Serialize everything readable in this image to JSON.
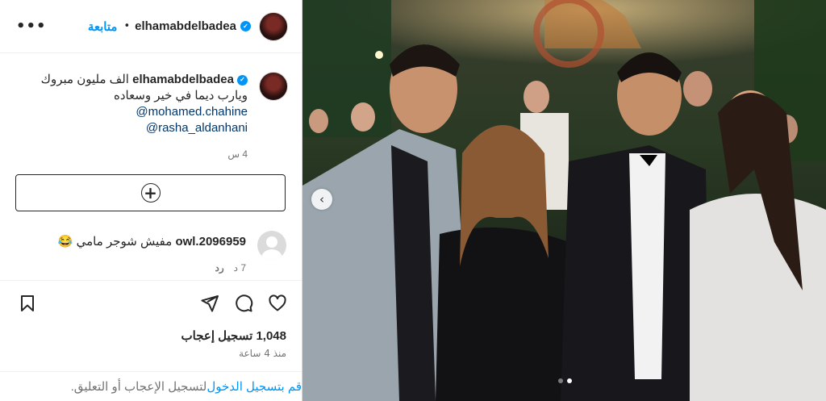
{
  "post": {
    "username": "elhamabdelbadea",
    "follow_label": "متابعة",
    "separator": "•",
    "more_label": "•••",
    "caption_line1": "الف مليون مبروك",
    "caption_line2": "ويارب ديما في خير وسعاده",
    "mentions": [
      "@mohamed.chahine",
      "@rasha_aldanhani"
    ],
    "caption_time": "4 س",
    "verified_mark": "✓"
  },
  "load_more": {
    "icon": "plus-circle-icon",
    "glyph": "+"
  },
  "comment": {
    "username": "owl.2096959",
    "text": "مفيش شوجر مامي 😂",
    "time": "7 د",
    "reply_label": "رد"
  },
  "stats": {
    "likes": "1,048 تسجيل إعجاب",
    "posted": "منذ 4 ساعة"
  },
  "login_prompt": {
    "link": "قم بتسجيل الدخول",
    "rest": " لتسجيل الإعجاب أو التعليق."
  },
  "carousel": {
    "prev_glyph": "‹",
    "slides": 2,
    "active_slide": 2
  },
  "colors": {
    "accent": "#0095f6",
    "mention": "#00376b",
    "muted": "#737373"
  }
}
